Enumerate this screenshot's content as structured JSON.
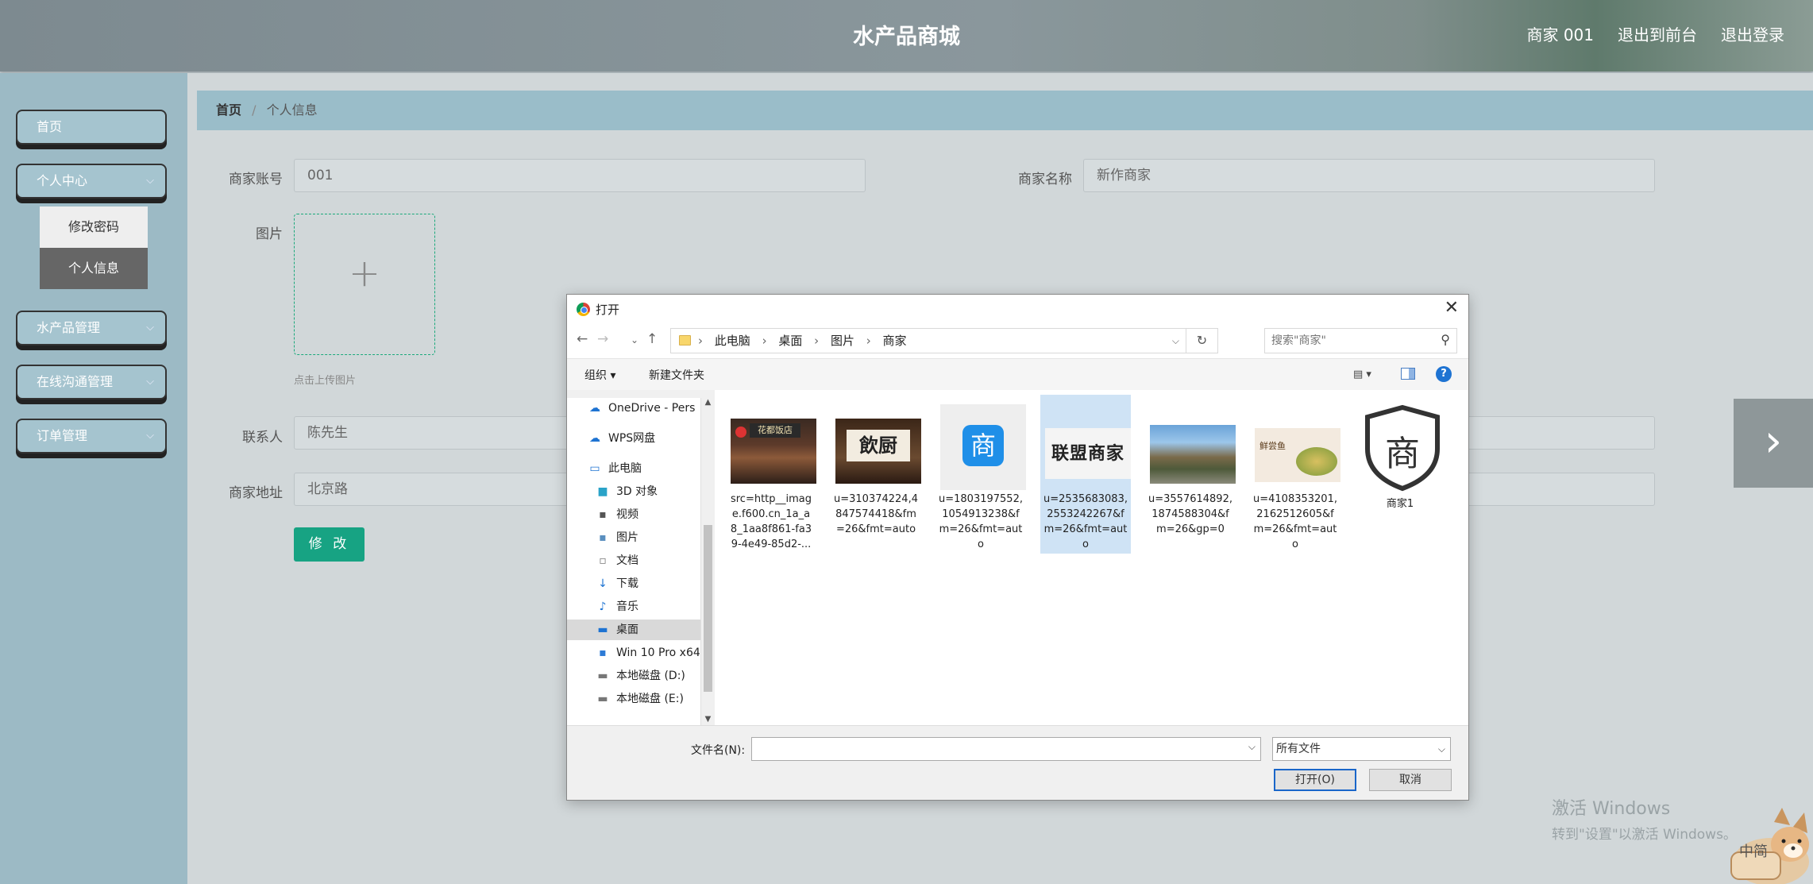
{
  "header": {
    "title": "水产品商城",
    "user": "商家 001",
    "back_front": "退出到前台",
    "logout": "退出登录"
  },
  "sidebar": {
    "items": [
      {
        "label": "首页"
      },
      {
        "label": "个人中心"
      },
      {
        "label": "水产品管理"
      },
      {
        "label": "在线沟通管理"
      },
      {
        "label": "订单管理"
      }
    ],
    "submenu": [
      {
        "label": "修改密码"
      },
      {
        "label": "个人信息"
      }
    ]
  },
  "breadcrumb": {
    "home": "首页",
    "sep": "/",
    "current": "个人信息"
  },
  "form": {
    "account_label": "商家账号",
    "account_value": "001",
    "name_label": "商家名称",
    "name_value": "新作商家",
    "image_label": "图片",
    "upload_plus": "+",
    "upload_hint": "点击上传图片",
    "contact_label": "联系人",
    "contact_value": "陈先生",
    "address_label": "商家地址",
    "address_value": "北京路",
    "submit_label": "修 改"
  },
  "next_arrow": "›",
  "dialog": {
    "title": "打开",
    "close": "✕",
    "nav": {
      "back": "←",
      "forward": "→",
      "recent": "⌄",
      "up": "↑"
    },
    "path": [
      "此电脑",
      "桌面",
      "图片",
      "商家"
    ],
    "path_sep": "›",
    "refresh": "↻",
    "search_placeholder": "搜索\"商家\"",
    "organize": "组织 ▾",
    "new_folder": "新建文件夹",
    "help": "?",
    "nav_items": [
      {
        "label": "OneDrive - Pers",
        "icon": "☁"
      },
      {
        "label": "WPS网盘",
        "icon": "☁"
      },
      {
        "label": "此电脑",
        "icon": "▭"
      },
      {
        "label": "3D 对象",
        "icon": "■"
      },
      {
        "label": "视频",
        "icon": "▪"
      },
      {
        "label": "图片",
        "icon": "▪"
      },
      {
        "label": "文档",
        "icon": "▫"
      },
      {
        "label": "下载",
        "icon": "↓"
      },
      {
        "label": "音乐",
        "icon": "♪"
      },
      {
        "label": "桌面",
        "icon": "▬"
      },
      {
        "label": "Win 10 Pro x64",
        "icon": "▪"
      },
      {
        "label": "本地磁盘 (D:)",
        "icon": "▬"
      },
      {
        "label": "本地磁盘 (E:)",
        "icon": "▬"
      }
    ],
    "files": [
      {
        "name": "src=http__image.f600.cn_1a_a8_1aa8f861-fa39-4e49-85d2-..."
      },
      {
        "name": "u=310374224,4847574418&fm=26&fmt=auto"
      },
      {
        "name": "u=1803197552,1054913238&fm=26&fmt=auto"
      },
      {
        "name": "u=2535683083,2553242267&fm=26&fmt=auto"
      },
      {
        "name": "u=3557614892,1874588304&fm=26&gp=0"
      },
      {
        "name": "u=4108353201,2162512605&fm=26&fmt=auto"
      },
      {
        "name": "商家1"
      }
    ],
    "thumb_text": {
      "f1": "花都饭店",
      "f2": "飲厨",
      "f3": "商",
      "f4": "联盟商家",
      "f6": "鲜尝鱼",
      "f7": "商"
    },
    "filename_label": "文件名(N):",
    "filetype": "所有文件",
    "open_btn": "打开(O)",
    "cancel_btn": "取消"
  },
  "watermark": {
    "line1": "激活 Windows",
    "line2": "转到\"设置\"以激活 Windows。"
  },
  "ime": "中简"
}
